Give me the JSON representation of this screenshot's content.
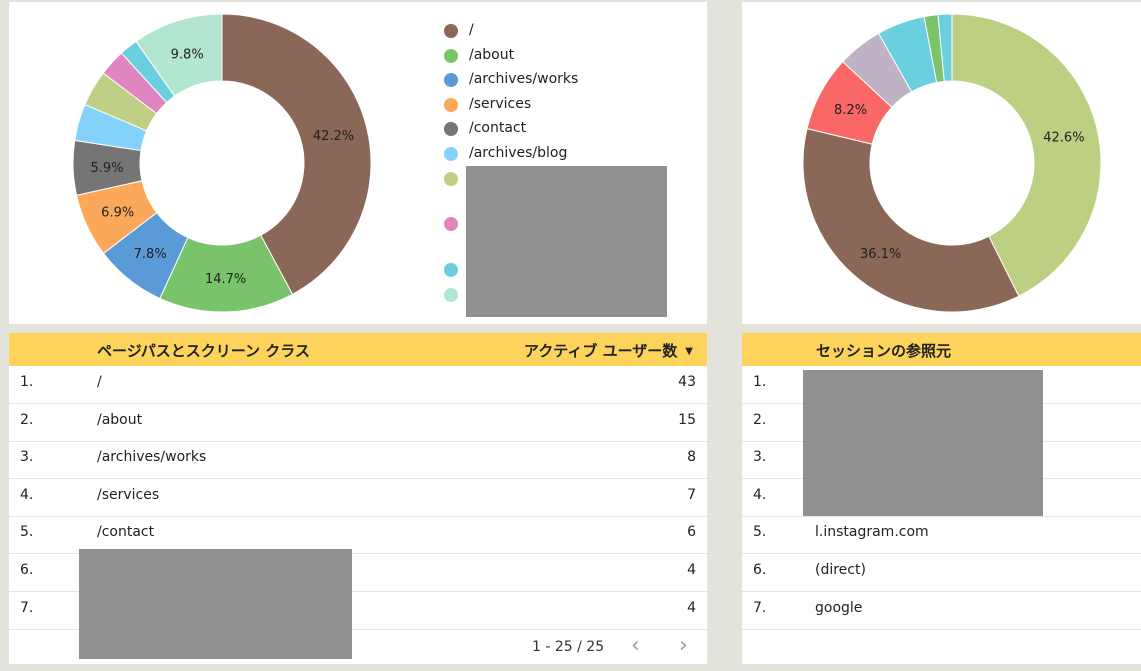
{
  "chart_data": [
    {
      "type": "pie",
      "donut": true,
      "series_name": "",
      "labels": [
        "/",
        "/about",
        "/archives/works",
        "/services",
        "/contact",
        "/archives/blog",
        "",
        "",
        "",
        ""
      ],
      "values": [
        42.2,
        14.7,
        7.8,
        6.9,
        5.9,
        4.0,
        3.9,
        2.9,
        2.0,
        9.8
      ],
      "value_labels": [
        "42.2%",
        "14.7%",
        "7.8%",
        "6.9%",
        "5.9%",
        "",
        "",
        "",
        "",
        "9.8%"
      ],
      "colors": [
        "#8a6757",
        "#79c46a",
        "#5a9ad6",
        "#fca85b",
        "#757575",
        "#84d2fa",
        "#bfcf85",
        "#df85bf",
        "#6ccfdf",
        "#b3e6d0"
      ],
      "legend": "right"
    },
    {
      "type": "pie",
      "donut": true,
      "labels": [
        "",
        "",
        "",
        "",
        "",
        "",
        ""
      ],
      "values": [
        42.6,
        36.1,
        8.2,
        4.9,
        5.2,
        1.5,
        1.5
      ],
      "value_labels": [
        "42.6%",
        "36.1%",
        "8.2%",
        "",
        "",
        "",
        ""
      ],
      "colors": [
        "#bccf82",
        "#8a6757",
        "#f96767",
        "#bfb2c5",
        "#6acfdf",
        "#7cc46c",
        "#6acfdf"
      ]
    }
  ],
  "table_left": {
    "col_dimension": "ページパスとスクリーン クラス",
    "col_metric": "アクティブ ユーザー数",
    "sort_icon": "triangle-down-icon",
    "rows": [
      {
        "idx": "1.",
        "path": "/",
        "value": "43"
      },
      {
        "idx": "2.",
        "path": "/about",
        "value": "15"
      },
      {
        "idx": "3.",
        "path": "/archives/works",
        "value": "8"
      },
      {
        "idx": "4.",
        "path": "/services",
        "value": "7"
      },
      {
        "idx": "5.",
        "path": "/contact",
        "value": "6"
      },
      {
        "idx": "6.",
        "path": "",
        "value": "4"
      },
      {
        "idx": "7.",
        "path": "",
        "value": "4"
      }
    ],
    "pager": "1 - 25 / 25",
    "prev_icon": "chevron-left-icon",
    "next_icon": "chevron-right-icon"
  },
  "table_right": {
    "col_dimension": "セッションの参照元",
    "rows": [
      {
        "idx": "1.",
        "source": ""
      },
      {
        "idx": "2.",
        "source": ""
      },
      {
        "idx": "3.",
        "source": ""
      },
      {
        "idx": "4.",
        "source": ""
      },
      {
        "idx": "5.",
        "source": "l.instagram.com"
      },
      {
        "idx": "6.",
        "source": "(direct)"
      },
      {
        "idx": "7.",
        "source": "google"
      }
    ]
  }
}
